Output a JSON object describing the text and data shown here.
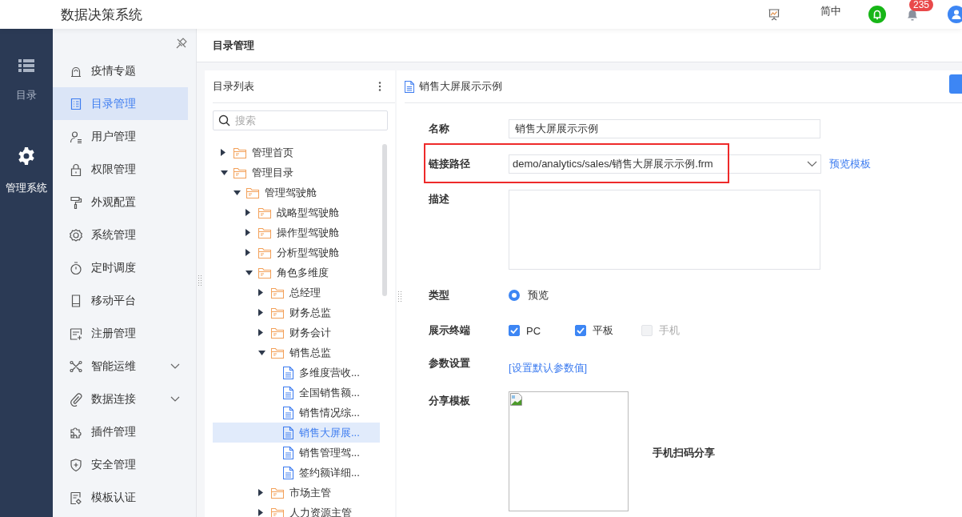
{
  "header": {
    "title": "数据决策系统",
    "language": "简中",
    "notification_count": "235"
  },
  "rail": [
    {
      "label": "目录",
      "selected": false
    },
    {
      "label": "管理系统",
      "selected": true
    }
  ],
  "menu": [
    {
      "label": "疫情专题",
      "selected": false,
      "has_submenu": false
    },
    {
      "label": "目录管理",
      "selected": true,
      "has_submenu": false
    },
    {
      "label": "用户管理",
      "selected": false,
      "has_submenu": false
    },
    {
      "label": "权限管理",
      "selected": false,
      "has_submenu": false
    },
    {
      "label": "外观配置",
      "selected": false,
      "has_submenu": false
    },
    {
      "label": "系统管理",
      "selected": false,
      "has_submenu": false
    },
    {
      "label": "定时调度",
      "selected": false,
      "has_submenu": false
    },
    {
      "label": "移动平台",
      "selected": false,
      "has_submenu": false
    },
    {
      "label": "注册管理",
      "selected": false,
      "has_submenu": false
    },
    {
      "label": "智能运维",
      "selected": false,
      "has_submenu": true
    },
    {
      "label": "数据连接",
      "selected": false,
      "has_submenu": true
    },
    {
      "label": "插件管理",
      "selected": false,
      "has_submenu": false
    },
    {
      "label": "安全管理",
      "selected": false,
      "has_submenu": false
    },
    {
      "label": "模板认证",
      "selected": false,
      "has_submenu": false
    }
  ],
  "page_title": "目录管理",
  "catalog": {
    "title": "目录列表",
    "search_placeholder": "搜索",
    "tree": [
      {
        "label": "管理首页",
        "kind": "folder",
        "expanded": false,
        "selected": false
      },
      {
        "label": "管理目录",
        "kind": "folder",
        "expanded": true,
        "selected": false,
        "children": [
          {
            "label": "管理驾驶舱",
            "kind": "folder",
            "expanded": true,
            "selected": false,
            "children": [
              {
                "label": "战略型驾驶舱",
                "kind": "folder",
                "expanded": false,
                "selected": false
              },
              {
                "label": "操作型驾驶舱",
                "kind": "folder",
                "expanded": false,
                "selected": false
              },
              {
                "label": "分析型驾驶舱",
                "kind": "folder",
                "expanded": false,
                "selected": false
              },
              {
                "label": "角色多维度",
                "kind": "folder",
                "expanded": true,
                "selected": false,
                "children": [
                  {
                    "label": "总经理",
                    "kind": "folder",
                    "expanded": false,
                    "selected": false
                  },
                  {
                    "label": "财务总监",
                    "kind": "folder",
                    "expanded": false,
                    "selected": false
                  },
                  {
                    "label": "财务会计",
                    "kind": "folder",
                    "expanded": false,
                    "selected": false
                  },
                  {
                    "label": "销售总监",
                    "kind": "folder",
                    "expanded": true,
                    "selected": false,
                    "children": [
                      {
                        "label": "多维度营收...",
                        "kind": "file",
                        "selected": false
                      },
                      {
                        "label": "全国销售额...",
                        "kind": "file",
                        "selected": false
                      },
                      {
                        "label": "销售情况综...",
                        "kind": "file",
                        "selected": false
                      },
                      {
                        "label": "销售大屏展...",
                        "kind": "file",
                        "selected": true
                      },
                      {
                        "label": "销售管理驾...",
                        "kind": "file",
                        "selected": false
                      },
                      {
                        "label": "签约额详细...",
                        "kind": "file",
                        "selected": false
                      }
                    ]
                  },
                  {
                    "label": "市场主管",
                    "kind": "folder",
                    "expanded": false,
                    "selected": false
                  },
                  {
                    "label": "人力资源主管",
                    "kind": "folder",
                    "expanded": false,
                    "selected": false
                  }
                ]
              }
            ]
          }
        ]
      }
    ]
  },
  "detail": {
    "title": "销售大屏展示示例",
    "fields": [
      {
        "kind": "text",
        "label": "名称",
        "value": "销售大屏展示示例"
      },
      {
        "kind": "select",
        "label": "链接路径",
        "value": "demo/analytics/sales/销售大屏展示示例.frm",
        "link": "预览模板",
        "highlighted": true
      },
      {
        "kind": "textarea",
        "label": "描述"
      },
      {
        "kind": "radio",
        "label": "类型",
        "options": [
          {
            "label": "预览",
            "selected": true
          }
        ]
      },
      {
        "kind": "checkbox",
        "label": "展示终端",
        "options": [
          {
            "label": "PC",
            "checked": true,
            "disabled": false
          },
          {
            "label": "平板",
            "checked": true,
            "disabled": false
          },
          {
            "label": "手机",
            "checked": false,
            "disabled": true
          }
        ]
      },
      {
        "kind": "link",
        "label": "参数设置",
        "link": "[设置默认参数值]"
      },
      {
        "kind": "share",
        "label": "分享模板",
        "caption": "手机扫码分享"
      }
    ]
  }
}
